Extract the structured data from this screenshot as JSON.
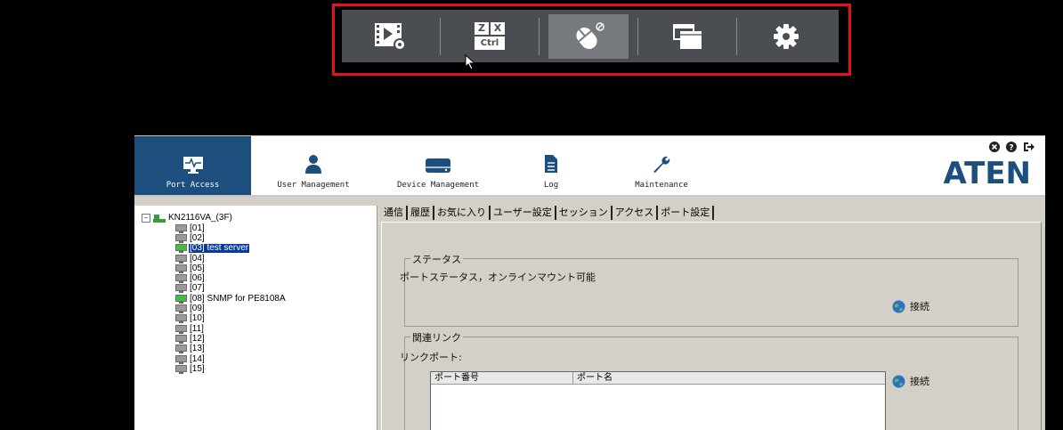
{
  "toolbar": {
    "buttons": [
      {
        "icon": "video-settings-icon"
      },
      {
        "icon": "keyboard-zx-ctrl-icon",
        "keys": [
          "Z",
          "X"
        ],
        "ctrl": "Ctrl"
      },
      {
        "icon": "mouse-icon",
        "active": true
      },
      {
        "icon": "windows-icon"
      },
      {
        "icon": "gear-icon"
      }
    ],
    "highlight_color": "#e0141e"
  },
  "nav": {
    "items": [
      {
        "label": "Port Access",
        "icon": "monitor-pulse-icon",
        "active": true
      },
      {
        "label": "User Management",
        "icon": "user-icon"
      },
      {
        "label": "Device Management",
        "icon": "device-icon"
      },
      {
        "label": "Log",
        "icon": "document-icon"
      },
      {
        "label": "Maintenance",
        "icon": "wrench-icon"
      }
    ],
    "accent": "#1d4f7e",
    "logo": "ATEN"
  },
  "tree": {
    "root": "KN2116VA_(3F)",
    "expander": "⊟",
    "items": [
      {
        "label": "[01]",
        "status": "offline"
      },
      {
        "label": "[02]",
        "status": "offline"
      },
      {
        "label": "[03] test server",
        "status": "online",
        "selected": true
      },
      {
        "label": "[04]",
        "status": "offline"
      },
      {
        "label": "[05]",
        "status": "offline"
      },
      {
        "label": "[06]",
        "status": "offline"
      },
      {
        "label": "[07]",
        "status": "offline"
      },
      {
        "label": "[08] SNMP for PE8108A",
        "status": "online"
      },
      {
        "label": "[09]",
        "status": "offline"
      },
      {
        "label": "[10]",
        "status": "offline"
      },
      {
        "label": "[11]",
        "status": "offline"
      },
      {
        "label": "[12]",
        "status": "offline"
      },
      {
        "label": "[13]",
        "status": "offline"
      },
      {
        "label": "[14]",
        "status": "offline"
      },
      {
        "label": "[15]",
        "status": "offline"
      }
    ]
  },
  "tabs": [
    "通信",
    "履歴",
    "お気に入り",
    "ユーザー設定",
    "セッション",
    "アクセス",
    "ポート設定"
  ],
  "status_group": {
    "title": "ステータス",
    "text": "ポートステータス，オンラインマウント可能",
    "connect_label": "接続"
  },
  "links_group": {
    "title": "関連リンク",
    "link_port_label": "リンクポート:",
    "columns": [
      "ポート番号",
      "ポート名"
    ],
    "connect_label": "接続"
  }
}
